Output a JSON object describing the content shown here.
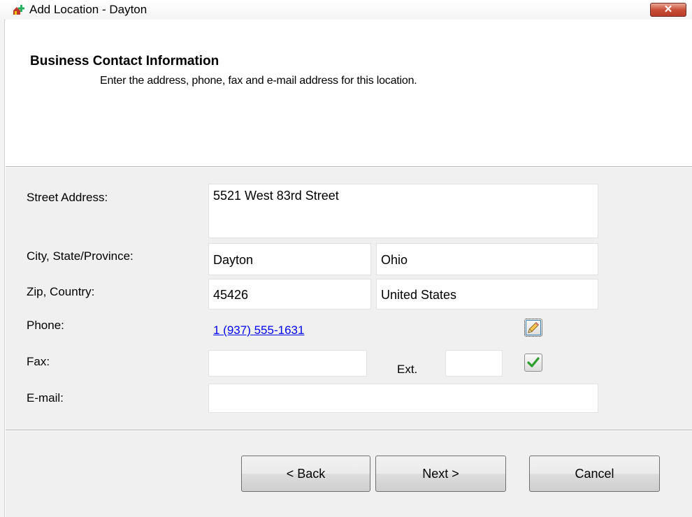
{
  "window": {
    "title": "Add Location - Dayton",
    "close_label": "✕"
  },
  "header": {
    "title": "Business Contact Information",
    "description": "Enter the address, phone, fax and e-mail address for this location."
  },
  "form": {
    "street_label": "Street Address:",
    "street_value": "5521 West 83rd Street",
    "city_state_label": "City, State/Province:",
    "city_value": "Dayton",
    "state_value": "Ohio",
    "zip_country_label": "Zip, Country:",
    "zip_value": "45426",
    "country_value": "United States",
    "phone_label": "Phone:",
    "phone_value": "1 (937) 555-1631",
    "fax_label": "Fax:",
    "fax_value": "",
    "ext_label": "Ext.",
    "ext_value": "",
    "email_label": "E-mail:",
    "email_value": ""
  },
  "icons": {
    "app": "add-location-icon",
    "edit_phone": "pencil-icon",
    "confirm": "checkmark-icon"
  },
  "buttons": {
    "back": "< Back",
    "next": "Next >",
    "cancel": "Cancel"
  }
}
